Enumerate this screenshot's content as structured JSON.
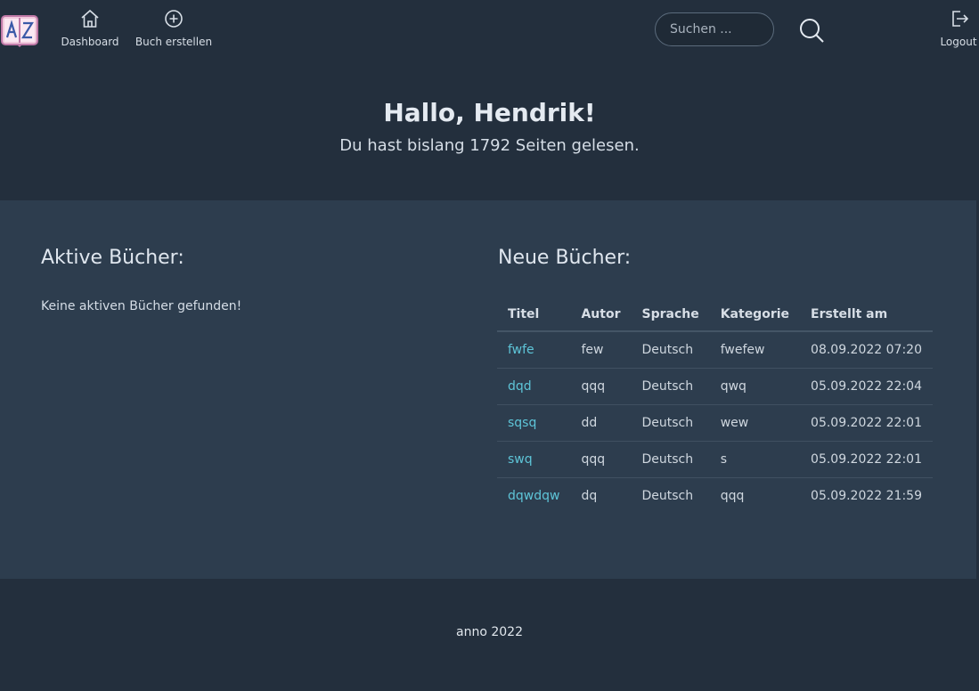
{
  "nav": {
    "items": [
      {
        "label": "Dashboard",
        "icon": "home-icon"
      },
      {
        "label": "Buch erstellen",
        "icon": "plus-circle-icon"
      }
    ],
    "search_placeholder": "Suchen ...",
    "logout_label": "Logout"
  },
  "hero": {
    "title": "Hallo, Hendrik!",
    "subtitle": "Du hast bislang 1792 Seiten gelesen."
  },
  "active_books": {
    "title": "Aktive Bücher:",
    "empty_message": "Keine aktiven Bücher gefunden!"
  },
  "new_books": {
    "title": "Neue Bücher:",
    "columns": [
      "Titel",
      "Autor",
      "Sprache",
      "Kategorie",
      "Erstellt am"
    ],
    "rows": [
      {
        "title": "fwfe",
        "author": "few",
        "language": "Deutsch",
        "category": "fwefew",
        "created": "08.09.2022 07:20"
      },
      {
        "title": "dqd",
        "author": "qqq",
        "language": "Deutsch",
        "category": "qwq",
        "created": "05.09.2022 22:04"
      },
      {
        "title": "sqsq",
        "author": "dd",
        "language": "Deutsch",
        "category": "wew",
        "created": "05.09.2022 22:01"
      },
      {
        "title": "swq",
        "author": "qqq",
        "language": "Deutsch",
        "category": "s",
        "created": "05.09.2022 22:01"
      },
      {
        "title": "dqwdqw",
        "author": "dq",
        "language": "Deutsch",
        "category": "qqq",
        "created": "05.09.2022 21:59"
      }
    ]
  },
  "footer": {
    "text": "anno 2022"
  },
  "colors": {
    "background": "#232f3d",
    "panel": "#2d3d4e",
    "link": "#5ec5d8"
  }
}
